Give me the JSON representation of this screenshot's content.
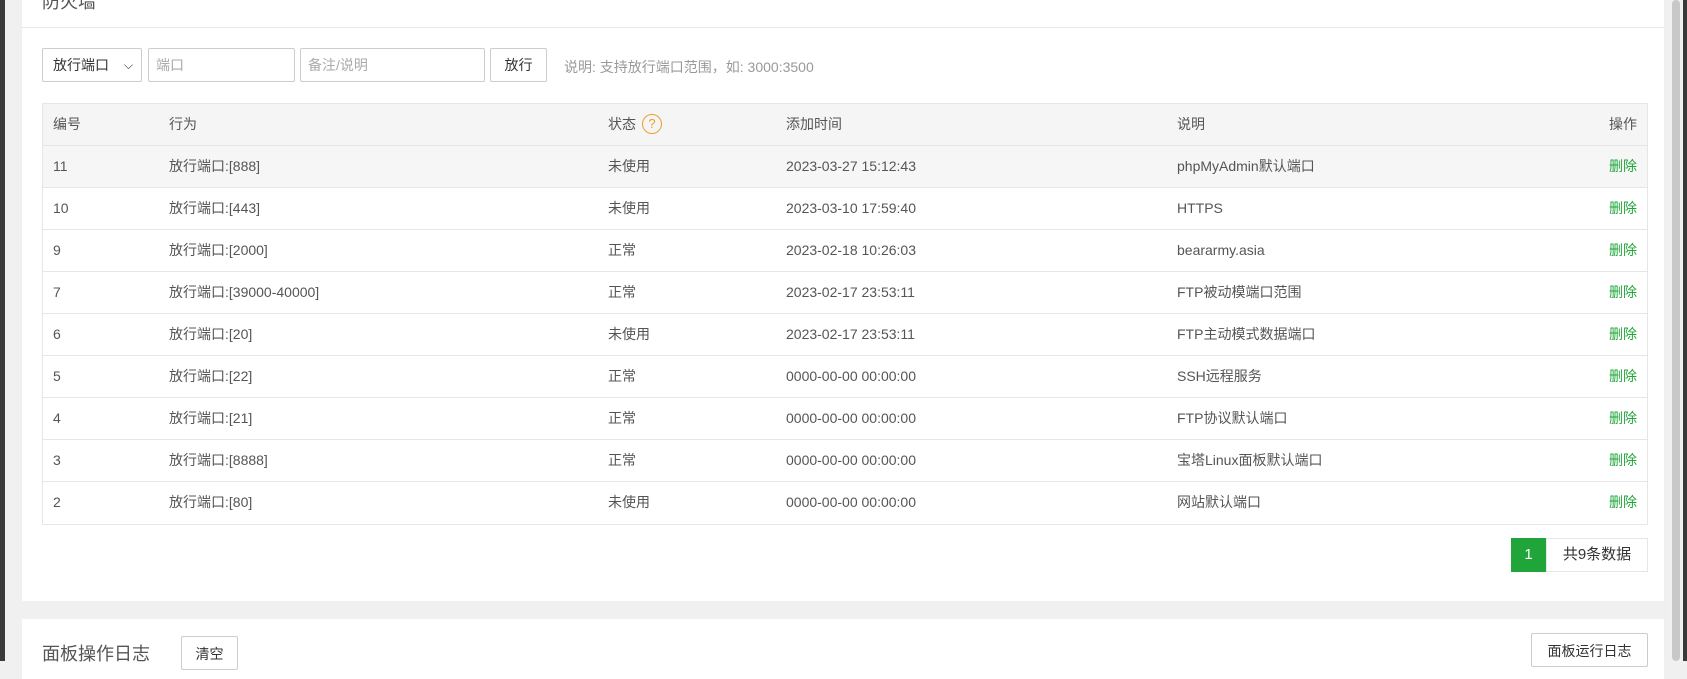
{
  "firewall": {
    "title": "防火墙",
    "toolbar": {
      "select_value": "放行端口",
      "port_placeholder": "端口",
      "note_placeholder": "备注/说明",
      "allow_label": "放行",
      "hint": "说明: 支持放行端口范围，如: 3000:3500"
    },
    "table": {
      "headers": [
        "编号",
        "行为",
        "状态",
        "添加时间",
        "说明",
        "操作"
      ],
      "rows": [
        {
          "id": "11",
          "action": "放行端口:[888]",
          "status": "未使用",
          "time": "2023-03-27 15:12:43",
          "note": "phpMyAdmin默认端口",
          "op": "删除"
        },
        {
          "id": "10",
          "action": "放行端口:[443]",
          "status": "未使用",
          "time": "2023-03-10 17:59:40",
          "note": "HTTPS",
          "op": "删除"
        },
        {
          "id": "9",
          "action": "放行端口:[2000]",
          "status": "正常",
          "time": "2023-02-18 10:26:03",
          "note": "beararmy.asia",
          "op": "删除"
        },
        {
          "id": "7",
          "action": "放行端口:[39000-40000]",
          "status": "正常",
          "time": "2023-02-17 23:53:11",
          "note": "FTP被动模端口范围",
          "op": "删除"
        },
        {
          "id": "6",
          "action": "放行端口:[20]",
          "status": "未使用",
          "time": "2023-02-17 23:53:11",
          "note": "FTP主动模式数据端口",
          "op": "删除"
        },
        {
          "id": "5",
          "action": "放行端口:[22]",
          "status": "正常",
          "time": "0000-00-00 00:00:00",
          "note": "SSH远程服务",
          "op": "删除"
        },
        {
          "id": "4",
          "action": "放行端口:[21]",
          "status": "正常",
          "time": "0000-00-00 00:00:00",
          "note": "FTP协议默认端口",
          "op": "删除"
        },
        {
          "id": "3",
          "action": "放行端口:[8888]",
          "status": "正常",
          "time": "0000-00-00 00:00:00",
          "note": "宝塔Linux面板默认端口",
          "op": "删除"
        },
        {
          "id": "2",
          "action": "放行端口:[80]",
          "status": "未使用",
          "time": "0000-00-00 00:00:00",
          "note": "网站默认端口",
          "op": "删除"
        }
      ]
    },
    "pager": {
      "current": "1",
      "total": "共9条数据"
    }
  },
  "oplog": {
    "title": "面板操作日志",
    "clear_label": "清空",
    "runlog_label": "面板运行日志"
  },
  "colors": {
    "accent": "#20a53a",
    "help": "#e8a033"
  },
  "icons": {
    "help": "question-circle-icon",
    "dropdown": "chevron-down-icon"
  }
}
